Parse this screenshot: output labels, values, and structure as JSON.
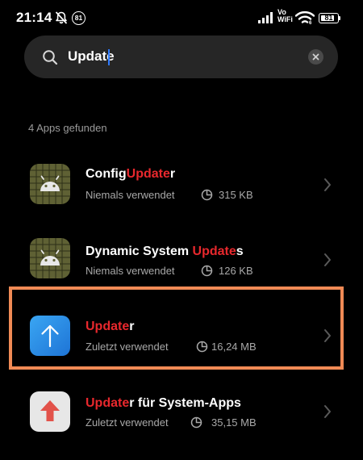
{
  "status_bar": {
    "time": "21:14",
    "notification_count": "81",
    "vowifi_top": "Vo",
    "vowifi_bottom": "WiFi",
    "battery_level": "81"
  },
  "search": {
    "query": "Update",
    "placeholder": ""
  },
  "results": {
    "count_label": "4 Apps gefunden",
    "apps": [
      {
        "name_prefix": "Config",
        "name_match": "Update",
        "name_suffix": "r",
        "last_used": "Niemals verwendet",
        "size": "315 KB",
        "icon": "android-grid-icon"
      },
      {
        "name_prefix": "Dynamic System ",
        "name_match": "Update",
        "name_suffix": "s",
        "last_used": "Niemals verwendet",
        "size": "126 KB",
        "icon": "android-grid-icon"
      },
      {
        "name_prefix": "",
        "name_match": "Update",
        "name_suffix": "r",
        "last_used": "Zuletzt verwendet",
        "size": "16,24 MB",
        "icon": "up-arrow-icon"
      },
      {
        "name_prefix": "",
        "name_match": "Update",
        "name_suffix": "r für System-Apps",
        "last_used": "Zuletzt verwendet",
        "size": "35,15 MB",
        "icon": "red-up-arrow-icon"
      }
    ]
  },
  "colors": {
    "background": "#000000",
    "search_bg": "#262626",
    "match_highlight": "#e8282d",
    "selection_outline": "#f08a55",
    "secondary_text": "#a8a8a8"
  }
}
